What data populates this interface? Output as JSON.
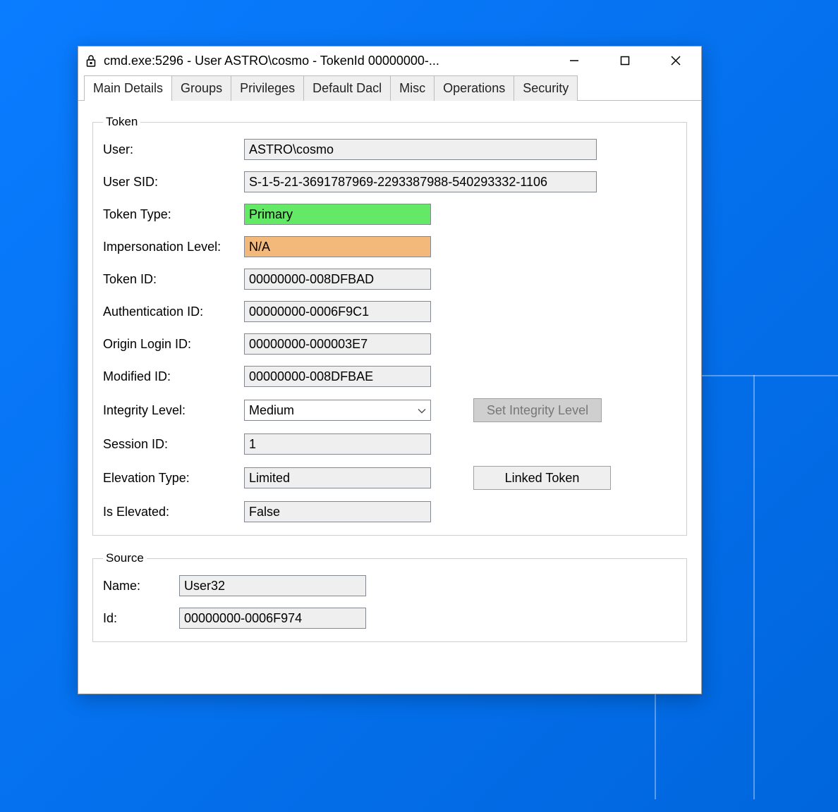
{
  "window": {
    "title": "cmd.exe:5296 - User ASTRO\\cosmo - TokenId 00000000-..."
  },
  "tabs": [
    {
      "label": "Main Details"
    },
    {
      "label": "Groups"
    },
    {
      "label": "Privileges"
    },
    {
      "label": "Default Dacl"
    },
    {
      "label": "Misc"
    },
    {
      "label": "Operations"
    },
    {
      "label": "Security"
    }
  ],
  "token_group": {
    "legend": "Token",
    "user_label": "User:",
    "user_value": "ASTRO\\cosmo",
    "user_sid_label": "User SID:",
    "user_sid_value": "S-1-5-21-3691787969-2293387988-540293332-1106",
    "token_type_label": "Token Type:",
    "token_type_value": "Primary",
    "imp_level_label": "Impersonation Level:",
    "imp_level_value": "N/A",
    "token_id_label": "Token ID:",
    "token_id_value": "00000000-008DFBAD",
    "auth_id_label": "Authentication ID:",
    "auth_id_value": "00000000-0006F9C1",
    "origin_login_label": "Origin Login ID:",
    "origin_login_value": "00000000-000003E7",
    "modified_id_label": "Modified ID:",
    "modified_id_value": "00000000-008DFBAE",
    "integrity_label": "Integrity Level:",
    "integrity_value": "Medium",
    "set_integrity_label": "Set Integrity Level",
    "session_id_label": "Session ID:",
    "session_id_value": "1",
    "elevation_type_label": "Elevation Type:",
    "elevation_type_value": "Limited",
    "linked_token_label": "Linked Token",
    "is_elevated_label": "Is Elevated:",
    "is_elevated_value": "False"
  },
  "source_group": {
    "legend": "Source",
    "name_label": "Name:",
    "name_value": "User32",
    "id_label": "Id:",
    "id_value": "00000000-0006F974"
  }
}
